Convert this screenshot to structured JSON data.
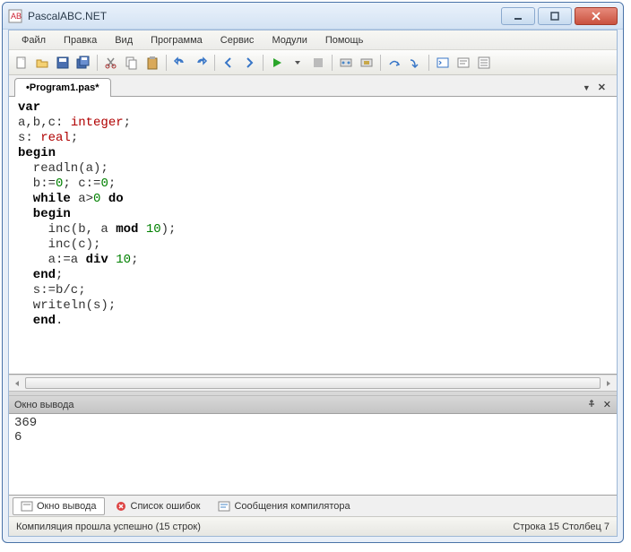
{
  "window": {
    "title": "PascalABC.NET"
  },
  "menu": {
    "file": "Файл",
    "edit": "Правка",
    "view": "Вид",
    "program": "Программа",
    "service": "Сервис",
    "modules": "Модули",
    "help": "Помощь"
  },
  "tab": {
    "name": "•Program1.pas*"
  },
  "code": {
    "l1": "var",
    "l2a": "a,b,c: ",
    "l2b": "integer",
    "l2c": ";",
    "l3a": "s: ",
    "l3b": "real",
    "l3c": ";",
    "l4": "begin",
    "l5": "  readln(a);",
    "l6a": "  b:=",
    "l6b": "0",
    "l6c": "; c:=",
    "l6d": "0",
    "l6e": ";",
    "l7a": "  while",
    "l7b": " a>",
    "l7c": "0",
    "l7d": " ",
    "l7e": "do",
    "l8": "  begin",
    "l9a": "    inc(b, a ",
    "l9b": "mod",
    "l9c": " ",
    "l9d": "10",
    "l9e": ");",
    "l10": "    inc(c);",
    "l11a": "    a:=a ",
    "l11b": "div",
    "l11c": " ",
    "l11d": "10",
    "l11e": ";",
    "l12": "  end",
    "l12b": ";",
    "l13": "  s:=b/c;",
    "l14": "  writeln(s);",
    "l15": "  end",
    "l15b": "."
  },
  "output": {
    "header": "Окно вывода",
    "content": "369\n6"
  },
  "bottomTabs": {
    "out": "Окно вывода",
    "err": "Список ошибок",
    "comp": "Сообщения компилятора"
  },
  "status": {
    "left": "Компиляция прошла успешно (15 строк)",
    "right": "Строка  15  Столбец  7"
  }
}
